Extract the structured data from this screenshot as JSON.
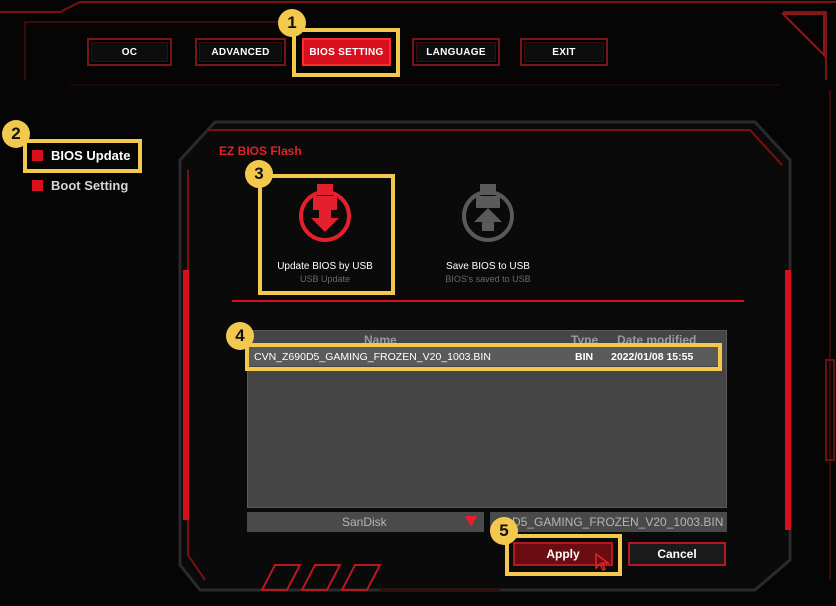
{
  "tabs": [
    {
      "label": "OC"
    },
    {
      "label": "ADVANCED"
    },
    {
      "label": "BIOS SETTING"
    },
    {
      "label": "LANGUAGE"
    },
    {
      "label": "EXIT"
    }
  ],
  "sidebar": {
    "items": [
      {
        "label": "BIOS Update"
      },
      {
        "label": "Boot Setting"
      }
    ]
  },
  "panel": {
    "title": "EZ BIOS Flash",
    "options": [
      {
        "title": "Update BIOS by USB",
        "subtitle": "USB Update"
      },
      {
        "title": "Save BIOS to USB",
        "subtitle": "BIOS's saved to USB"
      }
    ]
  },
  "file_list": {
    "headers": {
      "name": "Name",
      "type": "Type",
      "date": "Date modified"
    },
    "rows": [
      {
        "name": "CVN_Z690D5_GAMING_FROZEN_V20_1003.BIN",
        "type": "BIN",
        "date": "2022/01/08 15:55"
      }
    ]
  },
  "drive": {
    "selected": "SanDisk"
  },
  "selected_file": "D5_GAMING_FROZEN_V20_1003.BIN",
  "buttons": {
    "apply": "Apply",
    "cancel": "Cancel"
  },
  "badges": [
    "1",
    "2",
    "3",
    "4",
    "5"
  ],
  "colors": {
    "accent": "#d8101e",
    "highlight": "#f2c94c",
    "background": "#050505"
  }
}
